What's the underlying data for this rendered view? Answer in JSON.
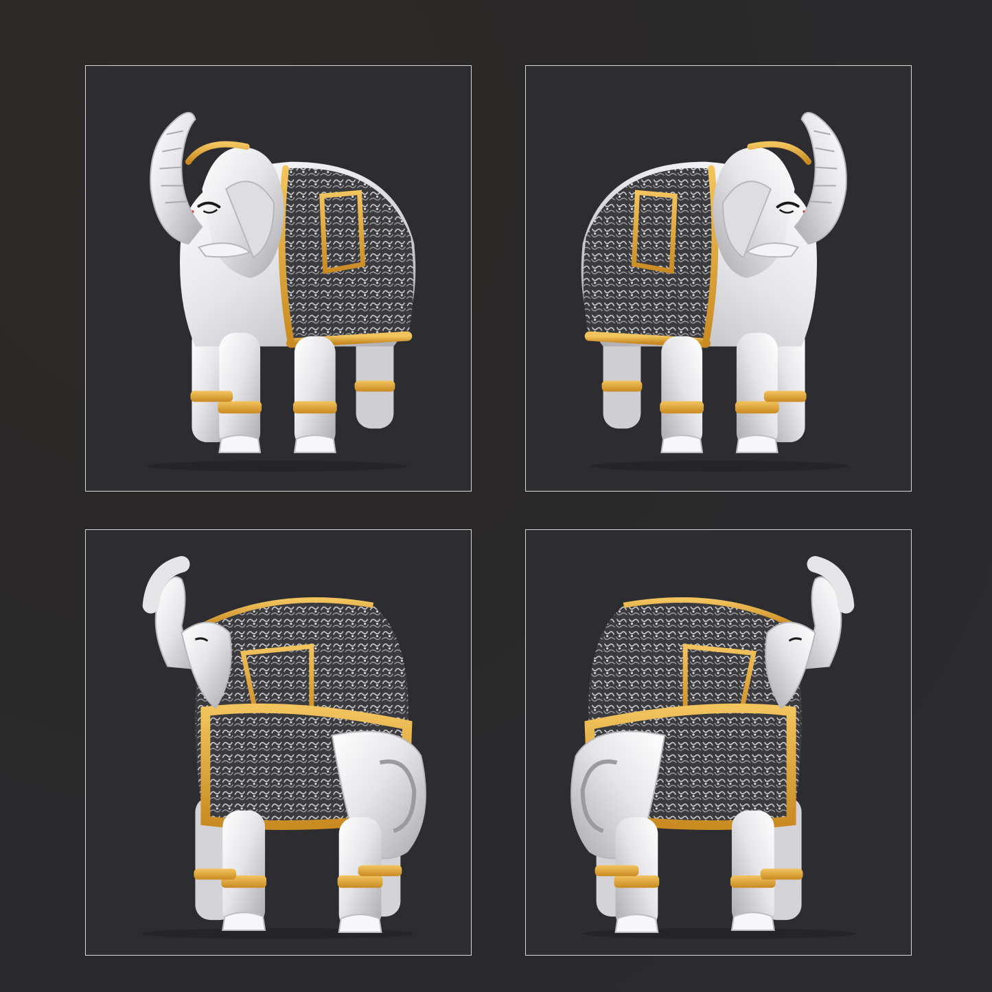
{
  "gallery": {
    "panels": [
      {
        "view": "front-left",
        "facing": "left"
      },
      {
        "view": "front-right",
        "facing": "right"
      },
      {
        "view": "rear-left",
        "facing": "left"
      },
      {
        "view": "rear-right",
        "facing": "right"
      }
    ]
  },
  "colors": {
    "background": "#2b2b2e",
    "panel": "#2d2d31",
    "panel_border": "#d8d8d8",
    "silver": "#e9e9ec",
    "silver_shade": "#b9b9be",
    "gold": "#e0a23a",
    "oxidized": "#3a3a3c",
    "tilak_red": "#d42a2a"
  }
}
